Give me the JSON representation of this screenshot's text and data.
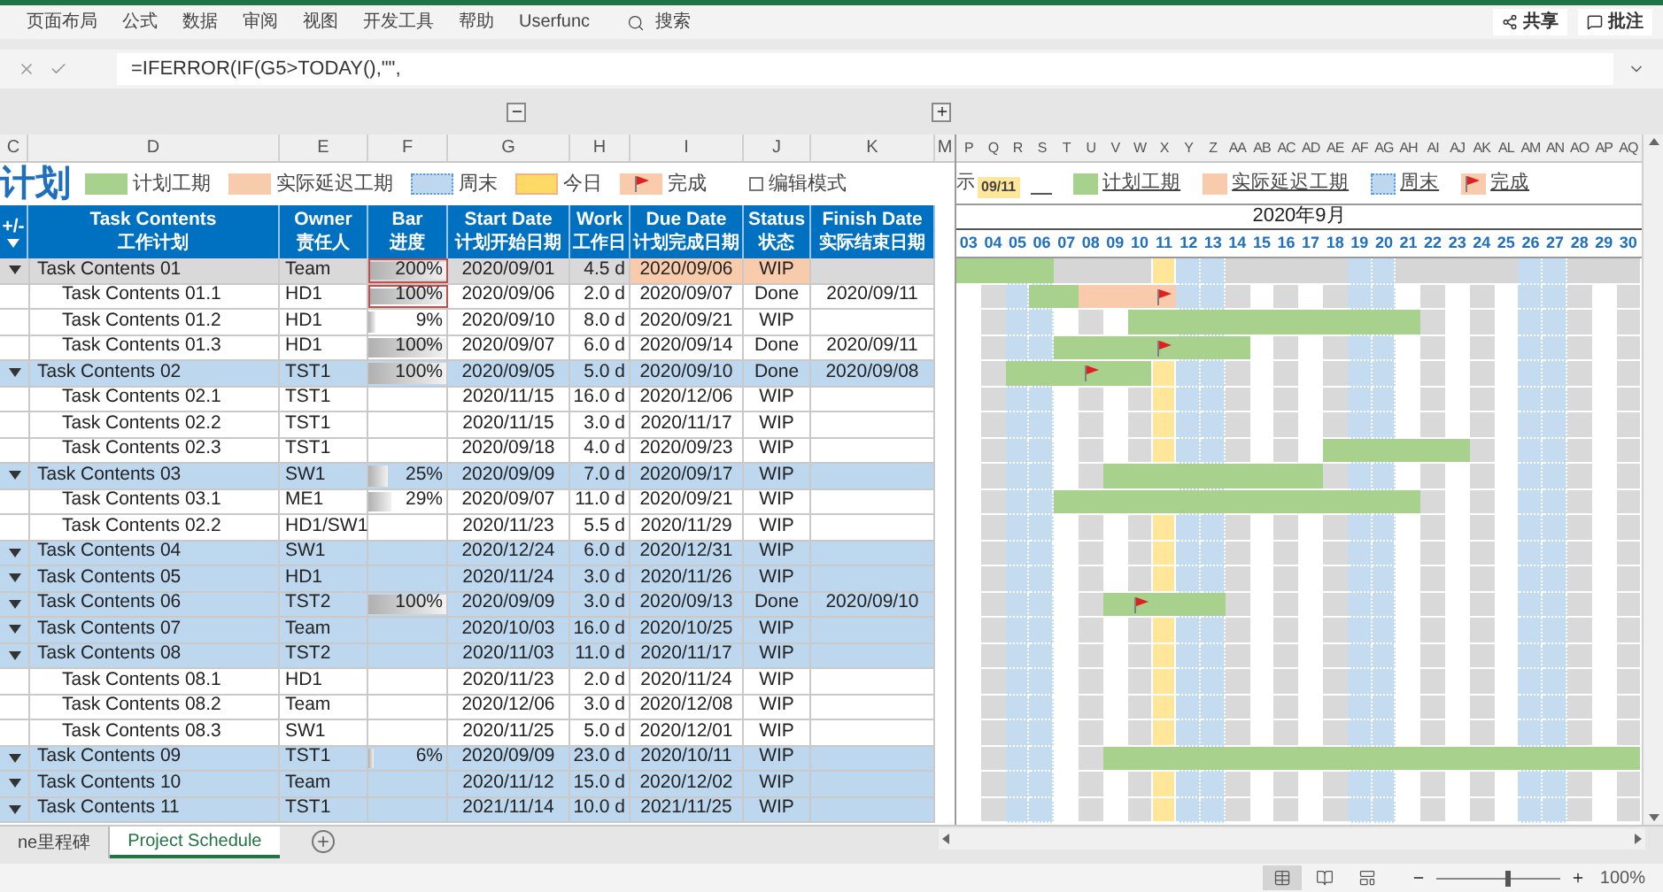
{
  "ribbon": {
    "tabs": [
      "页面布局",
      "公式",
      "数据",
      "审阅",
      "视图",
      "开发工具",
      "帮助",
      "Userfunc"
    ],
    "search": "搜索",
    "actions": [
      {
        "label": "共享",
        "kind": "share"
      },
      {
        "label": "批注",
        "kind": "comment"
      }
    ]
  },
  "formula_bar": {
    "formula": "=IFERROR(IF(G5>TODAY(),\"\","
  },
  "column_letters": [
    "C",
    "D",
    "E",
    "F",
    "G",
    "H",
    "I",
    "J",
    "K"
  ],
  "gap_column_letter": "M",
  "timeline_column_letters": [
    "P",
    "Q",
    "R",
    "S",
    "T",
    "U",
    "V",
    "W",
    "X",
    "Y",
    "Z",
    "AA",
    "AB",
    "AC",
    "AD",
    "AE",
    "AF",
    "AG",
    "AH",
    "AI",
    "AJ",
    "AK",
    "AL",
    "AM",
    "AN",
    "AO",
    "AP",
    "AQ"
  ],
  "legend": {
    "title": "计划",
    "items": [
      {
        "label": "计划工期",
        "kind": "plan"
      },
      {
        "label": "实际延迟工期",
        "kind": "delay"
      },
      {
        "label": "周末",
        "kind": "weekend"
      },
      {
        "label": "今日",
        "kind": "today"
      },
      {
        "label": "完成",
        "kind": "done"
      }
    ],
    "edit_mode": {
      "label": "编辑模式",
      "checked": false
    }
  },
  "timeline_legend": {
    "prefix": "示",
    "today_tag": "09/11",
    "items": [
      {
        "label": "计划工期",
        "kind": "plan"
      },
      {
        "label": "实际延迟工期",
        "kind": "delay"
      },
      {
        "label": "周末",
        "kind": "weekend"
      },
      {
        "label": "完成",
        "kind": "done"
      }
    ]
  },
  "table": {
    "columns": [
      {
        "en": "+/-"
      },
      {
        "en": "Task Contents",
        "zh": "工作计划"
      },
      {
        "en": "Owner",
        "zh": "责任人"
      },
      {
        "en": "Bar",
        "zh": "进度"
      },
      {
        "en": "Start Date",
        "zh": "计划开始日期"
      },
      {
        "en": "Work",
        "zh": "工作日"
      },
      {
        "en": "Due Date",
        "zh": "计划完成日期"
      },
      {
        "en": "Status",
        "zh": "状态"
      },
      {
        "en": "Finish Date",
        "zh": "实际结束日期"
      }
    ],
    "rows": [
      {
        "kind": "group",
        "name": "Task Contents 01",
        "owner": "Team",
        "progress": "200%",
        "level": 1,
        "outlined": true,
        "start": "2020/09/01",
        "work": "4.5 d",
        "due": "2020/09/06",
        "status": "WIP",
        "overdue": true,
        "selected": true
      },
      {
        "kind": "task",
        "name": "Task Contents 01.1",
        "owner": "HD1",
        "progress": "100%",
        "level": 1,
        "outlined": true,
        "start": "2020/09/06",
        "work": "2.0 d",
        "due": "2020/09/07",
        "status": "Done",
        "finish": "2020/09/11",
        "overdue": false,
        "selected": false
      },
      {
        "kind": "task",
        "name": "Task Contents 01.2",
        "owner": "HD1",
        "progress": "9%",
        "level": 0.09,
        "outlined": false,
        "start": "2020/09/10",
        "work": "8.0 d",
        "due": "2020/09/21",
        "status": "WIP",
        "overdue": false,
        "selected": false
      },
      {
        "kind": "task",
        "name": "Task Contents 01.3",
        "owner": "HD1",
        "progress": "100%",
        "level": 1,
        "outlined": false,
        "start": "2020/09/07",
        "work": "6.0 d",
        "due": "2020/09/14",
        "status": "Done",
        "finish": "2020/09/11",
        "overdue": false,
        "selected": false
      },
      {
        "kind": "group",
        "name": "Task Contents 02",
        "owner": "TST1",
        "progress": "100%",
        "level": 1,
        "outlined": false,
        "start": "2020/09/05",
        "work": "5.0 d",
        "due": "2020/09/10",
        "status": "Done",
        "finish": "2020/09/08",
        "overdue": false,
        "selected": false
      },
      {
        "kind": "task",
        "name": "Task Contents 02.1",
        "owner": "TST1",
        "start": "2020/11/15",
        "work": "16.0 d",
        "due": "2020/12/06",
        "status": "WIP",
        "overdue": false,
        "selected": false
      },
      {
        "kind": "task",
        "name": "Task Contents 02.2",
        "owner": "TST1",
        "start": "2020/11/15",
        "work": "3.0 d",
        "due": "2020/11/17",
        "status": "WIP",
        "overdue": false,
        "selected": false
      },
      {
        "kind": "task",
        "name": "Task Contents 02.3",
        "owner": "TST1",
        "start": "2020/09/18",
        "work": "4.0 d",
        "due": "2020/09/23",
        "status": "WIP",
        "overdue": false,
        "selected": false
      },
      {
        "kind": "group",
        "name": "Task Contents 03",
        "owner": "SW1",
        "progress": "25%",
        "level": 0.25,
        "outlined": false,
        "start": "2020/09/09",
        "work": "7.0 d",
        "due": "2020/09/17",
        "status": "WIP",
        "overdue": false,
        "selected": false
      },
      {
        "kind": "task",
        "name": "Task Contents 03.1",
        "owner": "ME1",
        "progress": "29%",
        "level": 0.29,
        "outlined": false,
        "start": "2020/09/07",
        "work": "11.0 d",
        "due": "2020/09/21",
        "status": "WIP",
        "overdue": false,
        "selected": false
      },
      {
        "kind": "task",
        "name": "Task Contents 02.2",
        "owner": "HD1/SW1",
        "start": "2020/11/23",
        "work": "5.5 d",
        "due": "2020/11/29",
        "status": "WIP",
        "overdue": false,
        "selected": false
      },
      {
        "kind": "group",
        "name": "Task Contents 04",
        "owner": "SW1",
        "start": "2020/12/24",
        "work": "6.0 d",
        "due": "2020/12/31",
        "status": "WIP",
        "overdue": false,
        "selected": false
      },
      {
        "kind": "group",
        "name": "Task Contents 05",
        "owner": "HD1",
        "start": "2020/11/24",
        "work": "3.0 d",
        "due": "2020/11/26",
        "status": "WIP",
        "overdue": false,
        "selected": false
      },
      {
        "kind": "group",
        "name": "Task Contents 06",
        "owner": "TST2",
        "progress": "100%",
        "level": 1,
        "outlined": false,
        "start": "2020/09/09",
        "work": "3.0 d",
        "due": "2020/09/13",
        "status": "Done",
        "finish": "2020/09/10",
        "overdue": false,
        "selected": false
      },
      {
        "kind": "group",
        "name": "Task Contents 07",
        "owner": "Team",
        "start": "2020/10/03",
        "work": "16.0 d",
        "due": "2020/10/25",
        "status": "WIP",
        "overdue": false,
        "selected": false
      },
      {
        "kind": "group",
        "name": "Task Contents 08",
        "owner": "TST2",
        "start": "2020/11/03",
        "work": "11.0 d",
        "due": "2020/11/17",
        "status": "WIP",
        "overdue": false,
        "selected": false
      },
      {
        "kind": "task",
        "name": "Task Contents 08.1",
        "owner": "HD1",
        "start": "2020/11/23",
        "work": "2.0 d",
        "due": "2020/11/24",
        "status": "WIP",
        "overdue": false,
        "selected": false
      },
      {
        "kind": "task",
        "name": "Task Contents 08.2",
        "owner": "Team",
        "start": "2020/12/06",
        "work": "3.0 d",
        "due": "2020/12/08",
        "status": "WIP",
        "overdue": false,
        "selected": false
      },
      {
        "kind": "task",
        "name": "Task Contents 08.3",
        "owner": "SW1",
        "start": "2020/11/25",
        "work": "5.0 d",
        "due": "2020/12/01",
        "status": "WIP",
        "overdue": false,
        "selected": false
      },
      {
        "kind": "group",
        "name": "Task Contents 09",
        "owner": "TST1",
        "progress": "6%",
        "level": 0.06,
        "outlined": false,
        "start": "2020/09/09",
        "work": "23.0 d",
        "due": "2020/10/11",
        "status": "WIP",
        "overdue": false,
        "selected": false
      },
      {
        "kind": "group",
        "name": "Task Contents 10",
        "owner": "Team",
        "start": "2020/11/12",
        "work": "15.0 d",
        "due": "2020/12/02",
        "status": "WIP",
        "overdue": false,
        "selected": false
      },
      {
        "kind": "group",
        "name": "Task Contents 11",
        "owner": "TST1",
        "start": "2021/11/14",
        "work": "10.0 d",
        "due": "2021/11/25",
        "status": "WIP",
        "overdue": false,
        "selected": false
      }
    ]
  },
  "timeline": {
    "month": "2020年9月",
    "days": [
      {
        "label": "03",
        "kind": "weekday"
      },
      {
        "label": "04",
        "kind": "weekday"
      },
      {
        "label": "05",
        "kind": "weekend"
      },
      {
        "label": "06",
        "kind": "weekend"
      },
      {
        "label": "07",
        "kind": "weekday"
      },
      {
        "label": "08",
        "kind": "weekday"
      },
      {
        "label": "09",
        "kind": "weekday"
      },
      {
        "label": "10",
        "kind": "weekday"
      },
      {
        "label": "11",
        "kind": "today"
      },
      {
        "label": "12",
        "kind": "weekend"
      },
      {
        "label": "13",
        "kind": "weekend"
      },
      {
        "label": "14",
        "kind": "weekday"
      },
      {
        "label": "15",
        "kind": "weekday"
      },
      {
        "label": "16",
        "kind": "weekday"
      },
      {
        "label": "17",
        "kind": "weekday"
      },
      {
        "label": "18",
        "kind": "weekday"
      },
      {
        "label": "19",
        "kind": "weekend"
      },
      {
        "label": "20",
        "kind": "weekend"
      },
      {
        "label": "21",
        "kind": "weekday"
      },
      {
        "label": "22",
        "kind": "weekday"
      },
      {
        "label": "23",
        "kind": "weekday"
      },
      {
        "label": "24",
        "kind": "weekday"
      },
      {
        "label": "25",
        "kind": "weekday"
      },
      {
        "label": "26",
        "kind": "weekend"
      },
      {
        "label": "27",
        "kind": "weekend"
      },
      {
        "label": "28",
        "kind": "weekday"
      },
      {
        "label": "29",
        "kind": "weekday"
      },
      {
        "label": "30",
        "kind": "weekday"
      }
    ]
  },
  "sheet_tabs": [
    {
      "label": "ne里程碑",
      "selected": false
    },
    {
      "label": "Project Schedule",
      "selected": true
    }
  ],
  "status_bar": {
    "views": [
      {
        "kind": "normal",
        "selected": true
      },
      {
        "kind": "page-layout",
        "selected": false
      },
      {
        "kind": "page-break",
        "selected": false
      }
    ],
    "zoom": {
      "level": 0.55,
      "reading": "100%"
    }
  }
}
